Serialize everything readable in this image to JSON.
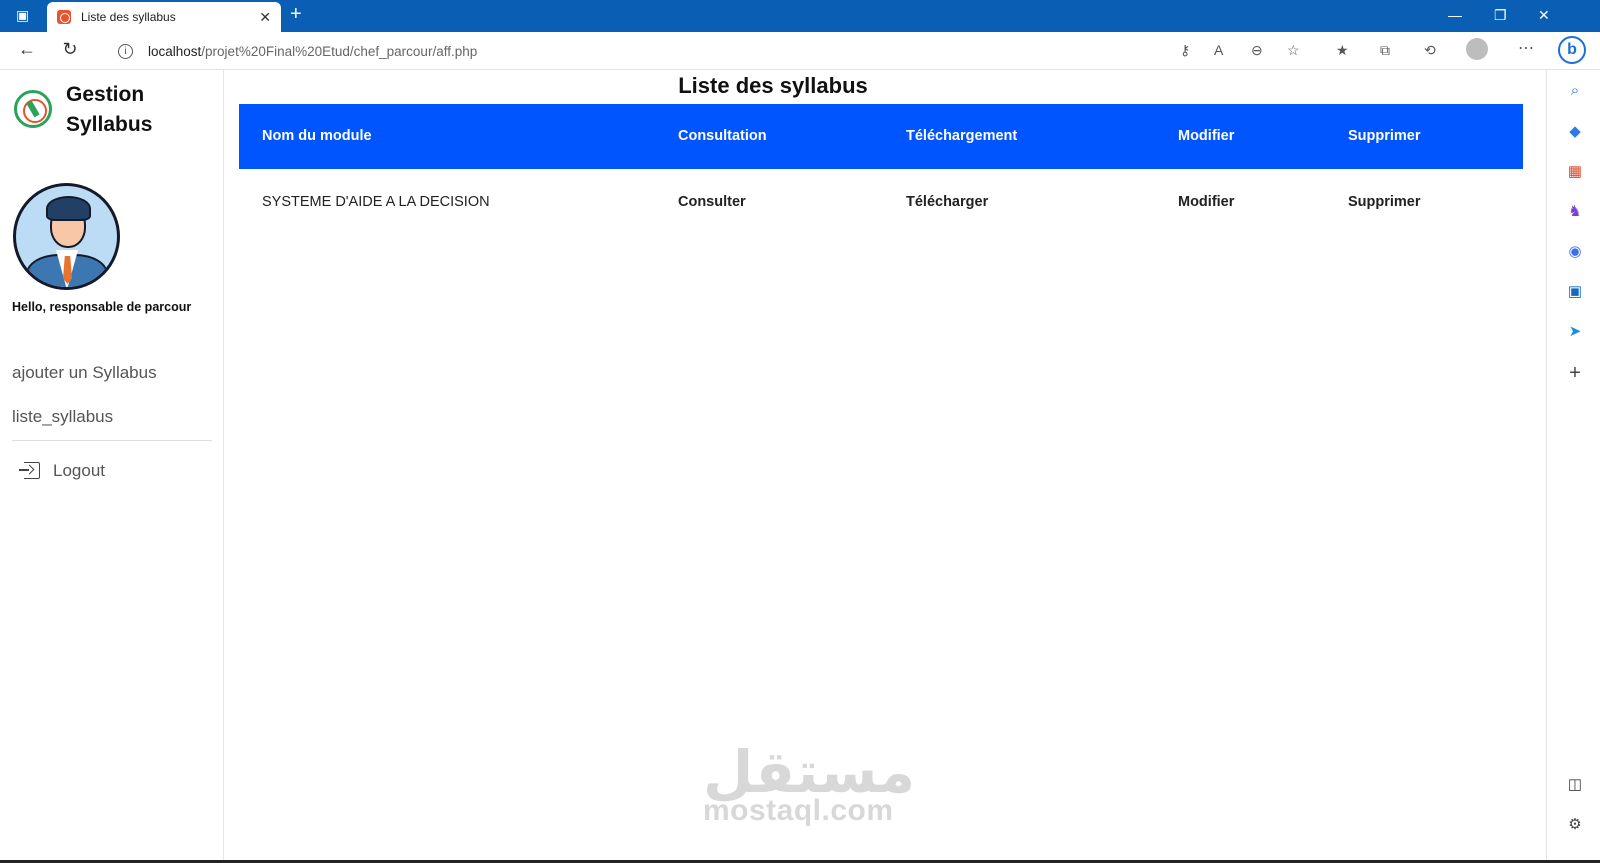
{
  "browser": {
    "tab_title": "Liste des syllabus",
    "tab_close": "✕",
    "new_tab": "+",
    "url_host": "localhost",
    "url_path": "/projet%20Final%20Etud/chef_parcour/aff.php"
  },
  "sidebar": {
    "brand_line1": "Gestion",
    "brand_line2": "Syllabus",
    "greeting": "Hello, responsable de parcour",
    "menu": [
      {
        "label": "ajouter un Syllabus"
      },
      {
        "label": "liste_syllabus"
      }
    ],
    "logout": "Logout"
  },
  "main": {
    "title": "Liste des syllabus",
    "columns": [
      "Nom du module",
      "Consultation",
      "Téléchargement",
      "Modifier",
      "Supprimer"
    ],
    "rows": [
      {
        "module": "SYSTEME D'AIDE A LA DECISION",
        "consult": "Consulter",
        "download": "Télécharger",
        "edit": "Modifier",
        "delete": "Supprimer"
      }
    ]
  },
  "watermark": {
    "arabic": "مستقل",
    "latin": "mostaql.com"
  },
  "colors": {
    "titlebar": "#0a5eb3",
    "table_header": "#0055ff"
  }
}
